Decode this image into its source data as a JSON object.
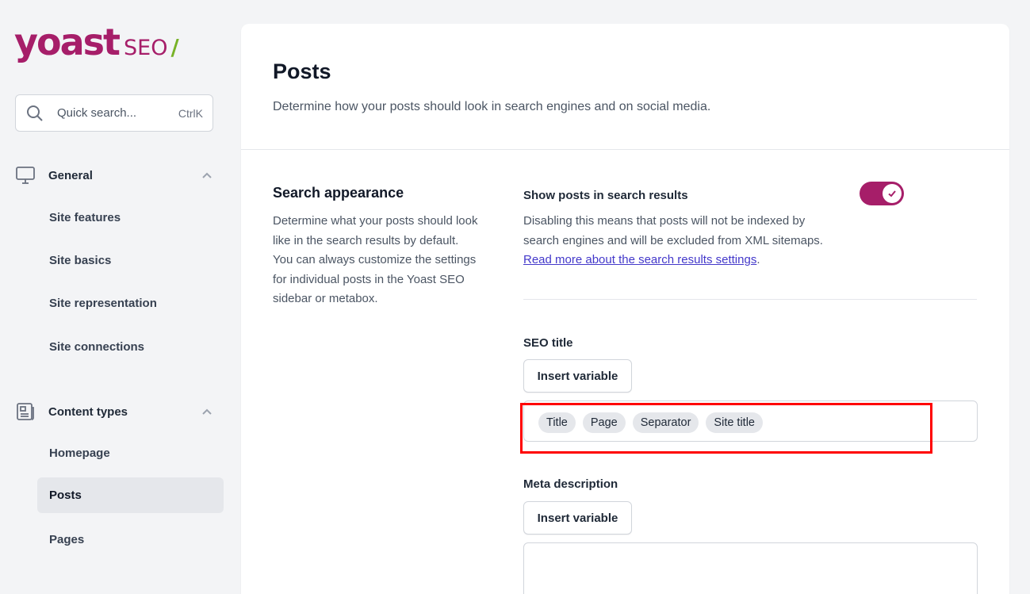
{
  "brand": {
    "logo_main": "yoast",
    "logo_seo": "SEO",
    "logo_slash": "/",
    "accent_color": "#a61e69",
    "slash_color": "#77b227"
  },
  "search": {
    "placeholder": "Quick search...",
    "shortcut": "CtrlK"
  },
  "sidebar": {
    "groups": [
      {
        "label": "General",
        "icon": "desktop-icon",
        "expanded": true,
        "items": [
          {
            "label": "Site features"
          },
          {
            "label": "Site basics"
          },
          {
            "label": "Site representation"
          },
          {
            "label": "Site connections"
          }
        ]
      },
      {
        "label": "Content types",
        "icon": "newspaper-icon",
        "expanded": true,
        "items": [
          {
            "label": "Homepage"
          },
          {
            "label": "Posts",
            "active": true
          },
          {
            "label": "Pages"
          }
        ]
      }
    ]
  },
  "page": {
    "title": "Posts",
    "description": "Determine how your posts should look in search engines and on social media."
  },
  "search_appearance": {
    "title": "Search appearance",
    "description": "Determine what your posts should look like in the search results by default. You can always customize the settings for individual posts in the Yoast SEO sidebar or metabox."
  },
  "show_in_search": {
    "label": "Show posts in search results",
    "description_text": "Disabling this means that posts will not be indexed by search engines and will be excluded from XML sitemaps. ",
    "link_text": "Read more about the search results settings",
    "trailing": ".",
    "enabled": true
  },
  "seo_title": {
    "label": "SEO title",
    "insert_button": "Insert variable",
    "variables": [
      "Title",
      "Page",
      "Separator",
      "Site title"
    ]
  },
  "meta_description": {
    "label": "Meta description",
    "insert_button": "Insert variable",
    "value": ""
  }
}
